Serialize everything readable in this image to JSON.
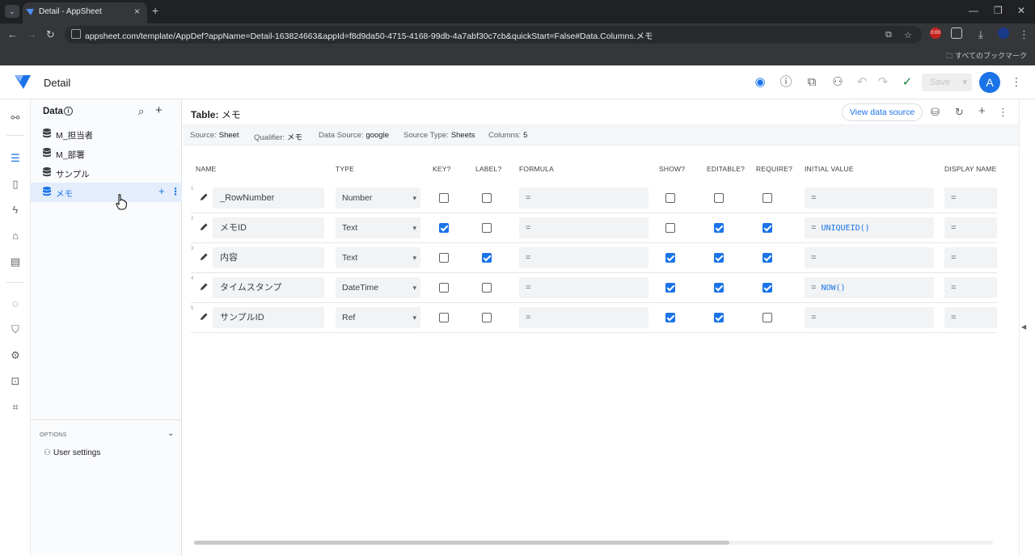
{
  "browser": {
    "tab_title": "Detail - AppSheet",
    "url": "appsheet.com/template/AppDef?appName=Detail-163824663&appId=f8d9da50-4715-4168-99db-4a7abf30c7cb&quickStart=False#Data.Columns.メモ",
    "bookmarks_label": "すべてのブックマーク",
    "profile_badge": "0:00"
  },
  "app": {
    "title": "Detail",
    "save_label": "Save",
    "avatar_letter": "A"
  },
  "data_panel": {
    "heading": "Data",
    "tables": [
      {
        "label": "M_担当者",
        "selected": false
      },
      {
        "label": "M_部署",
        "selected": false
      },
      {
        "label": "サンプル",
        "selected": false
      },
      {
        "label": "メモ",
        "selected": true
      }
    ],
    "options_heading": "OPTIONS",
    "user_settings_label": "User settings"
  },
  "main": {
    "table_label": "Table:",
    "table_name": "メモ",
    "view_data_source_label": "View data source",
    "meta": {
      "source_label": "Source:",
      "source_value": "Sheet",
      "qualifier_label": "Qualifier:",
      "qualifier_value": "メモ",
      "datasource_label": "Data Source:",
      "datasource_value": "google",
      "sourcetype_label": "Source Type:",
      "sourcetype_value": "Sheets",
      "columns_label": "Columns:",
      "columns_value": "5"
    },
    "column_headers": {
      "name": "NAME",
      "type": "TYPE",
      "key": "KEY?",
      "label": "LABEL?",
      "formula": "FORMULA",
      "show": "SHOW?",
      "editable": "EDITABLE?",
      "require": "REQUIRE?",
      "initial_value": "INITIAL VALUE",
      "display_name": "DISPLAY NAME"
    },
    "rows": [
      {
        "num": "1",
        "name": "_RowNumber",
        "type": "Number",
        "key": false,
        "label": false,
        "formula": "=",
        "show": false,
        "editable": false,
        "require": false,
        "initial_eq": "=",
        "initial_fx": "",
        "display": "="
      },
      {
        "num": "2",
        "name": "メモID",
        "type": "Text",
        "key": true,
        "label": false,
        "formula": "=",
        "show": false,
        "editable": true,
        "require": true,
        "initial_eq": "=",
        "initial_fx": "UNIQUEID()",
        "display": "="
      },
      {
        "num": "3",
        "name": "内容",
        "type": "Text",
        "key": false,
        "label": true,
        "formula": "=",
        "show": true,
        "editable": true,
        "require": true,
        "initial_eq": "=",
        "initial_fx": "",
        "display": "="
      },
      {
        "num": "4",
        "name": "タイムスタンプ",
        "type": "DateTime",
        "key": false,
        "label": false,
        "formula": "=",
        "show": true,
        "editable": true,
        "require": true,
        "initial_eq": "=",
        "initial_fx": "NOW()",
        "display": "="
      },
      {
        "num": "5",
        "name": "サンプルID",
        "type": "Ref",
        "key": false,
        "label": false,
        "formula": "=",
        "show": true,
        "editable": true,
        "require": false,
        "initial_eq": "=",
        "initial_fx": "",
        "display": "="
      }
    ]
  },
  "colors": {
    "accent": "#1a73e8",
    "chrome_dark": "#202124",
    "selected_bg": "#e3edfc"
  }
}
